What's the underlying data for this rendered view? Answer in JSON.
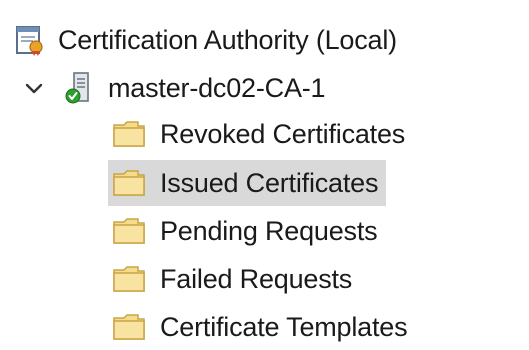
{
  "tree": {
    "root": {
      "label": "Certification Authority (Local)",
      "icon": "certification-authority-icon"
    },
    "server": {
      "label": "master-dc02-CA-1",
      "icon": "ca-server-icon",
      "expanded": true,
      "status_color": "#2e9e2e"
    },
    "children": [
      {
        "label": "Revoked Certificates",
        "icon": "folder-icon",
        "selected": false
      },
      {
        "label": "Issued Certificates",
        "icon": "folder-icon",
        "selected": true
      },
      {
        "label": "Pending Requests",
        "icon": "folder-icon",
        "selected": false
      },
      {
        "label": "Failed Requests",
        "icon": "folder-icon",
        "selected": false
      },
      {
        "label": "Certificate Templates",
        "icon": "folder-icon",
        "selected": false
      }
    ]
  },
  "colors": {
    "selection_background": "#d9d9d9",
    "folder_fill": "#f5dc8a",
    "text": "#1a1a1a"
  }
}
